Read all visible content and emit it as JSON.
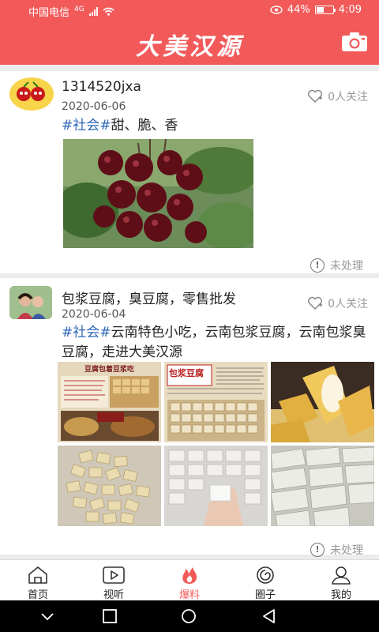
{
  "status_bar": {
    "carrier": "中国电信",
    "network": "4G",
    "battery": "44%",
    "battery_level": 0.44,
    "time": "4:09"
  },
  "header": {
    "title": "大美汉源"
  },
  "posts": [
    {
      "username": "1314520jxa",
      "date": "2020-06-06",
      "follow_label": "0人关注",
      "tag": "#社会#",
      "text": "甜、脆、香",
      "status": "未处理"
    },
    {
      "username": "包浆豆腐，臭豆腐，零售批发",
      "date": "2020-06-04",
      "follow_label": "0人关注",
      "tag": "#社会#",
      "text": "云南特色小吃，云南包浆豆腐，云南包浆臭豆腐，走进大美汉源",
      "status": "未处理",
      "photo_texts": [
        "豆腐包着豆浆吃",
        "包浆豆腐"
      ]
    }
  ],
  "tabbar": {
    "items": [
      {
        "label": "首页",
        "icon": "home-icon"
      },
      {
        "label": "视听",
        "icon": "play-icon"
      },
      {
        "label": "爆料",
        "icon": "flame-icon",
        "active": true
      },
      {
        "label": "圈子",
        "icon": "circle-icon"
      },
      {
        "label": "我的",
        "icon": "user-icon"
      }
    ]
  },
  "colors": {
    "accent": "#f25a5a",
    "tag": "#2f68b8",
    "muted": "#999999"
  }
}
